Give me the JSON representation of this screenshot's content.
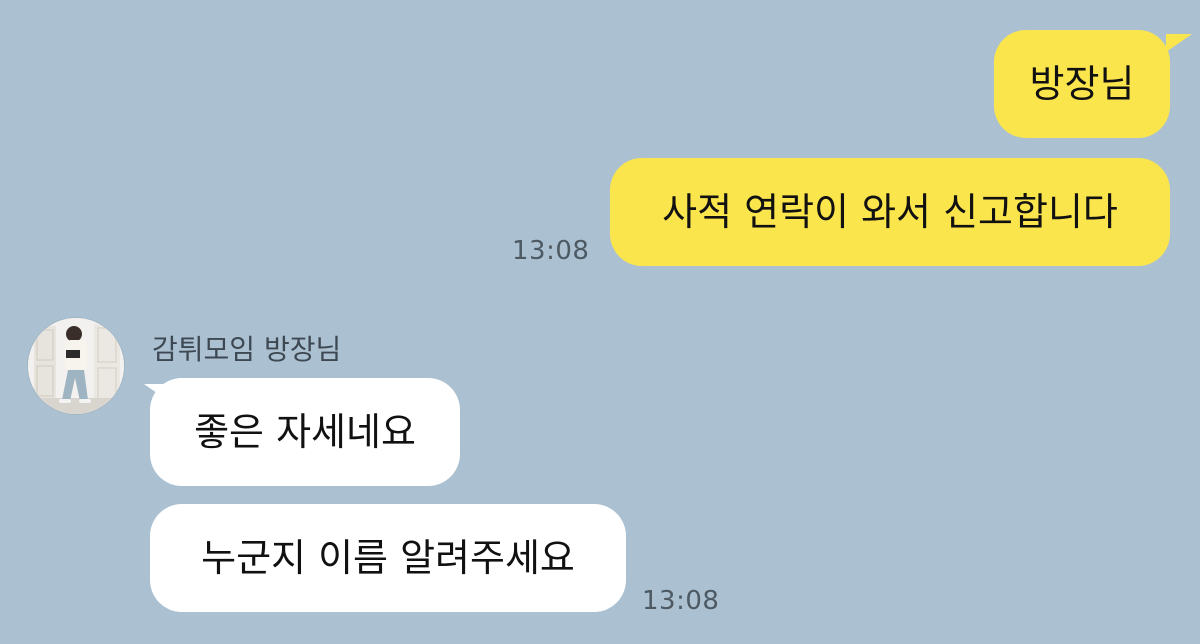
{
  "messages": {
    "out1": "방장님",
    "out2": "사적 연락이 와서 신고합니다",
    "out_time": "13:08",
    "sender_name": "감튀모임 방장님",
    "in1": "좋은 자세네요",
    "in2": "누군지 이름 알려주세요",
    "in_time": "13:08"
  },
  "colors": {
    "background": "#abc1d1",
    "outgoing_bubble": "#fbe54d",
    "incoming_bubble": "#ffffff"
  },
  "icons": {
    "avatar": "profile-photo"
  }
}
